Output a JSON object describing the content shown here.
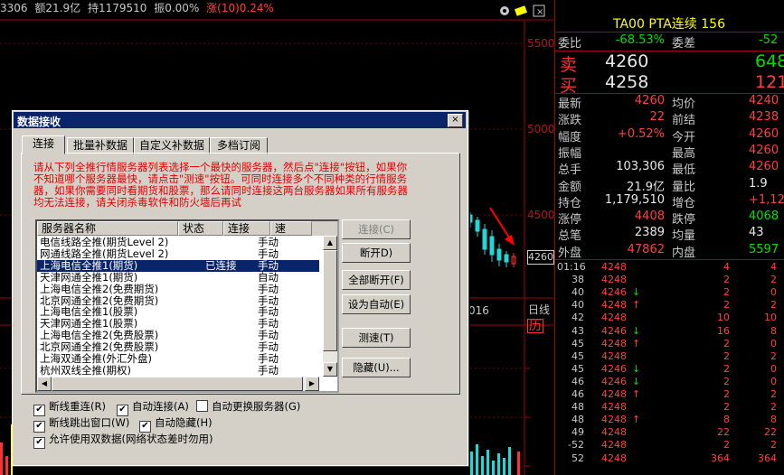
{
  "topbar": {
    "vol": "3306",
    "amount": "额21.9亿",
    "hold": "持1179510",
    "amp": "振0.00%",
    "rise": "涨(10)0.24%"
  },
  "chart": {
    "y_labels": [
      "5500",
      "5000",
      "4500"
    ],
    "current_price_tag": "4260",
    "date_label": "016",
    "tab_daily": "日线",
    "tab_other": "历"
  },
  "colors": {
    "up": "#ff4040",
    "down": "#00e000",
    "axis": "#a0001a",
    "dialog_title": "#0a246a"
  },
  "quote": {
    "title": "TA00  PTA连续  156",
    "weibi_label": "委比",
    "weibi": "-68.53%",
    "weicha_label": "委差",
    "weicha": "-52",
    "sell_label": "卖",
    "sell_price": "4260",
    "sell_vol": "648",
    "buy_label": "买",
    "buy_price": "4258",
    "buy_vol": "121",
    "rows": [
      {
        "k": "最新",
        "v": "4260",
        "k2": "均价",
        "v2": "4240"
      },
      {
        "k": "涨跌",
        "v": "22",
        "k2": "前结",
        "v2": "4238"
      },
      {
        "k": "幅度",
        "v": "+0.52%",
        "k2": "今开",
        "v2": "4260"
      },
      {
        "k": "振幅",
        "v": "",
        "k2": "最高",
        "v2": "4260"
      },
      {
        "k": "总手",
        "v": "103,306",
        "k2": "最低",
        "v2": "4260"
      },
      {
        "k": "金额",
        "v": "21.9亿",
        "k2": "量比",
        "v2": "1.9"
      },
      {
        "k": "持仓",
        "v": "1,179,510",
        "k2": "增仓",
        "v2": "+1,12"
      },
      {
        "k": "涨停",
        "v": "4408",
        "k2": "跌停",
        "v2": "4068"
      },
      {
        "k": "总笔",
        "v": "2389",
        "k2": "均量",
        "v2": "43"
      },
      {
        "k": "外盘",
        "v": "47862",
        "k2": "内盘",
        "v2": "5597"
      }
    ]
  },
  "ticks": [
    {
      "t": "01:16",
      "p": "4248",
      "a": "",
      "q": "4",
      "o": "4"
    },
    {
      "t": "38",
      "p": "4248",
      "a": "",
      "q": "2",
      "o": "2"
    },
    {
      "t": "40",
      "p": "4246",
      "a": "↓",
      "q": "2",
      "o": "0"
    },
    {
      "t": "40",
      "p": "4248",
      "a": "↑",
      "q": "2",
      "o": "2"
    },
    {
      "t": "42",
      "p": "4248",
      "a": "",
      "q": "10",
      "o": "10"
    },
    {
      "t": "43",
      "p": "4246",
      "a": "↓",
      "q": "16",
      "o": "8"
    },
    {
      "t": "45",
      "p": "4248",
      "a": "↑",
      "q": "2",
      "o": "0"
    },
    {
      "t": "45",
      "p": "4248",
      "a": "",
      "q": "2",
      "o": "2"
    },
    {
      "t": "45",
      "p": "4246",
      "a": "↓",
      "q": "2",
      "o": "0"
    },
    {
      "t": "46",
      "p": "4246",
      "a": "↓",
      "q": "2",
      "o": "0"
    },
    {
      "t": "46",
      "p": "4248",
      "a": "↑",
      "q": "2",
      "o": "2"
    },
    {
      "t": "48",
      "p": "4248",
      "a": "",
      "q": "2",
      "o": "2"
    },
    {
      "t": "48",
      "p": "4248",
      "a": "↑",
      "q": "8",
      "o": "8"
    },
    {
      "t": "49",
      "p": "4248",
      "a": "",
      "q": "22",
      "o": "22"
    },
    {
      "t": "-52",
      "p": "4248",
      "a": "",
      "q": "2",
      "o": "2"
    },
    {
      "t": "52",
      "p": "4248",
      "a": "",
      "q": "364",
      "o": "364"
    }
  ],
  "dialog": {
    "title": "数据接收",
    "close": "×",
    "tabs": [
      "连接",
      "批量补数据",
      "自定义补数据",
      "多档订阅"
    ],
    "notice": "请从下列全推行情服务器列表选择一个最快的服务器，然后点\"连接\"按钮，如果你不知道哪个服务器最快，请点击\"测速\"按钮。可同时连接多个不同种类的行情服务器，如果你需要同时看期货和股票，那么请同时连接这两台服务器如果所有服务器均无法连接，请关闭杀毒软件和防火墙后再试",
    "columns": [
      "服务器名称",
      "状态",
      "连接",
      "速"
    ],
    "servers": [
      {
        "name": "电信线路全推(期货Level 2)",
        "status": "",
        "conn": "手动"
      },
      {
        "name": "网通线路全推(期货Level 2)",
        "status": "",
        "conn": "手动"
      },
      {
        "name": "上海电信全推1(期货)",
        "status": "已连接",
        "conn": "手动"
      },
      {
        "name": "天津网通全推1(期货)",
        "status": "",
        "conn": "自动"
      },
      {
        "name": "上海电信全推2(免费期货)",
        "status": "",
        "conn": "手动"
      },
      {
        "name": "北京网通全推2(免费期货)",
        "status": "",
        "conn": "手动"
      },
      {
        "name": "上海电信全推1(股票)",
        "status": "",
        "conn": "手动"
      },
      {
        "name": "天津网通全推1(股票)",
        "status": "",
        "conn": "手动"
      },
      {
        "name": "上海电信全推2(免费股票)",
        "status": "",
        "conn": "手动"
      },
      {
        "name": "北京网通全推2(免费股票)",
        "status": "",
        "conn": "手动"
      },
      {
        "name": "上海双通全推(外汇外盘)",
        "status": "",
        "conn": "手动"
      },
      {
        "name": "杭州双线全推(期权)",
        "status": "",
        "conn": "手动"
      }
    ],
    "selected_index": 2,
    "buttons": {
      "connect": "连接(C)",
      "disconnect": "断开D)",
      "disconnect_all": "全部断开(F)",
      "set_auto": "设为自动(E)",
      "speed_test": "测速(T)",
      "hide": "隐藏(U)..."
    },
    "options": {
      "reconnect": "断线重连(R)",
      "auto_connect": "自动连接(A)",
      "auto_switch": "自动更换服务器(G)",
      "popup_on_drop": "断线跳出窗口(W)",
      "auto_hide": "自动隐藏(H)",
      "dual_data": "允许使用双数据(网络状态差时勿用)"
    },
    "option_states": {
      "reconnect": true,
      "auto_connect": true,
      "auto_switch": false,
      "popup_on_drop": true,
      "auto_hide": true,
      "dual_data": true
    }
  }
}
